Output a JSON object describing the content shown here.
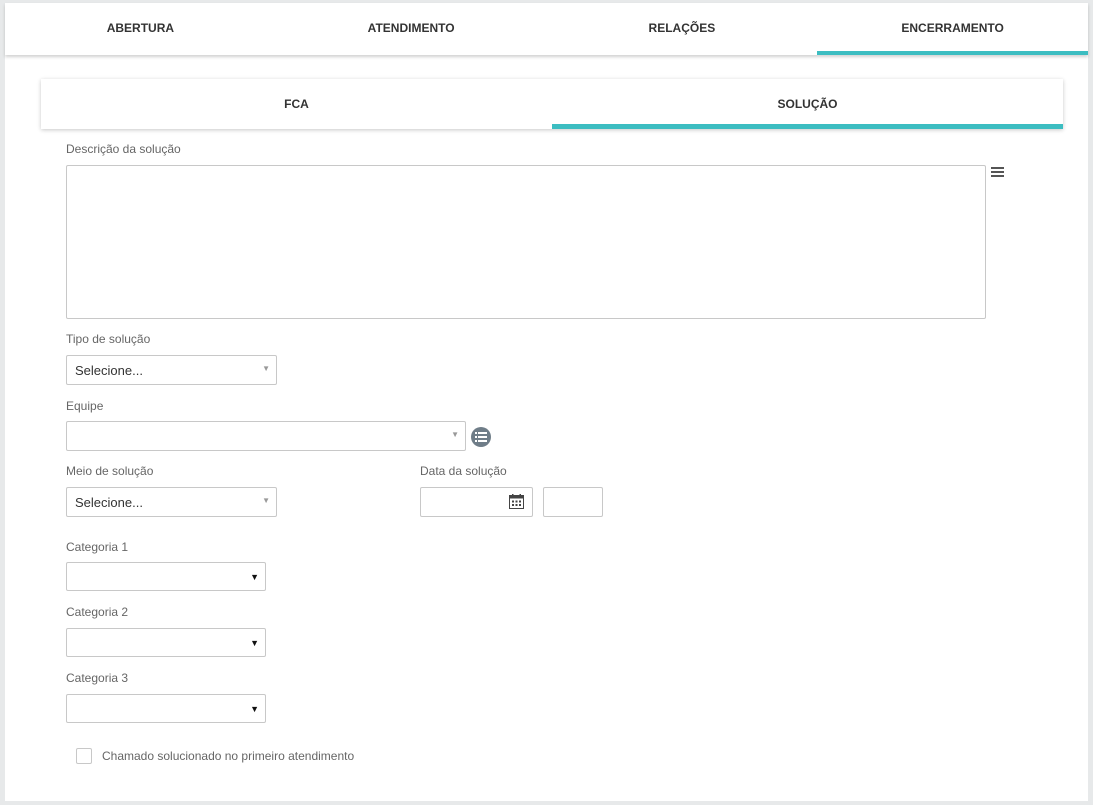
{
  "top_tabs": [
    {
      "label": "ABERTURA",
      "active": false
    },
    {
      "label": "ATENDIMENTO",
      "active": false
    },
    {
      "label": "RELAÇÕES",
      "active": false
    },
    {
      "label": "ENCERRAMENTO",
      "active": true
    }
  ],
  "sub_tabs": [
    {
      "label": "FCA",
      "active": false
    },
    {
      "label": "SOLUÇÃO",
      "active": true
    }
  ],
  "accent_color": "#3cbdc1",
  "form": {
    "descricao_label": "Descrição da solução",
    "descricao_value": "",
    "tipo_label": "Tipo de solução",
    "tipo_value": "Selecione...",
    "equipe_label": "Equipe",
    "equipe_value": "",
    "meio_label": "Meio de solução",
    "meio_value": "Selecione...",
    "data_label": "Data da solução",
    "data_value": "",
    "hora_value": "",
    "categoria1_label": "Categoria 1",
    "categoria1_value": "",
    "categoria2_label": "Categoria 2",
    "categoria2_value": "",
    "categoria3_label": "Categoria 3",
    "categoria3_value": "",
    "checkbox_label": "Chamado solucionado no primeiro atendimento",
    "checkbox_checked": false
  },
  "icons": {
    "editor_menu": "hamburger-menu-icon",
    "equipe_list": "list-circle-icon",
    "date_picker": "calendar-icon"
  }
}
